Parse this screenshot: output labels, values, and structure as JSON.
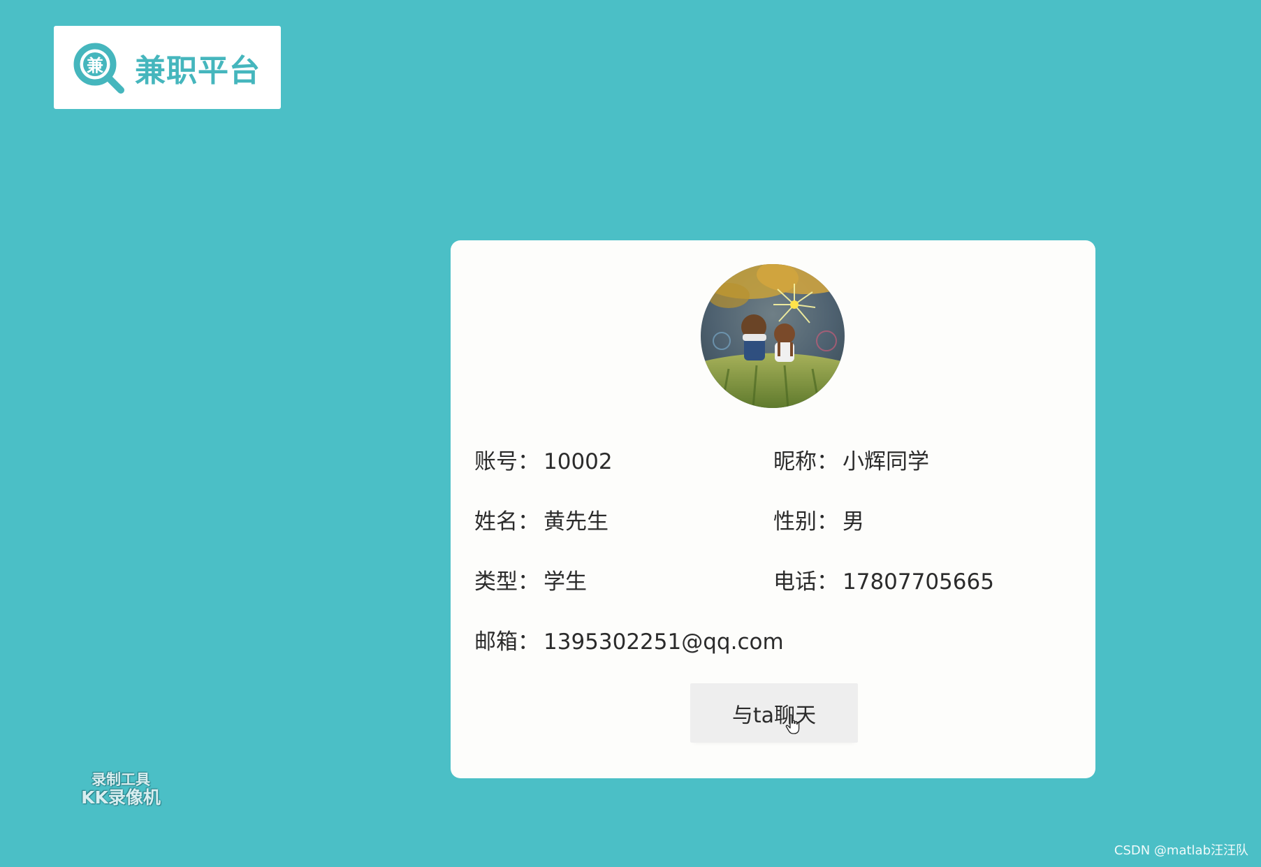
{
  "header": {
    "logo_glyph": "兼",
    "logo_text": "兼职平台"
  },
  "profile": {
    "fields": {
      "account_label": "账号",
      "account_value": "10002",
      "nickname_label": "昵称",
      "nickname_value": "小辉同学",
      "name_label": "姓名",
      "name_value": "黄先生",
      "gender_label": "性别",
      "gender_value": "男",
      "type_label": "类型",
      "type_value": "学生",
      "phone_label": "电话",
      "phone_value": "17807705665",
      "email_label": "邮箱",
      "email_value": "1395302251@qq.com"
    },
    "separator": "：",
    "chat_button_label": "与ta聊天"
  },
  "watermarks": {
    "recorder_line1": "录制工具",
    "recorder_line2": "KK录像机",
    "csdn": "CSDN @matlab汪汪队"
  },
  "colors": {
    "background": "#4bbfc6",
    "brand": "#45b6bd",
    "card": "#fdfdfb",
    "button": "#eeeeee"
  }
}
